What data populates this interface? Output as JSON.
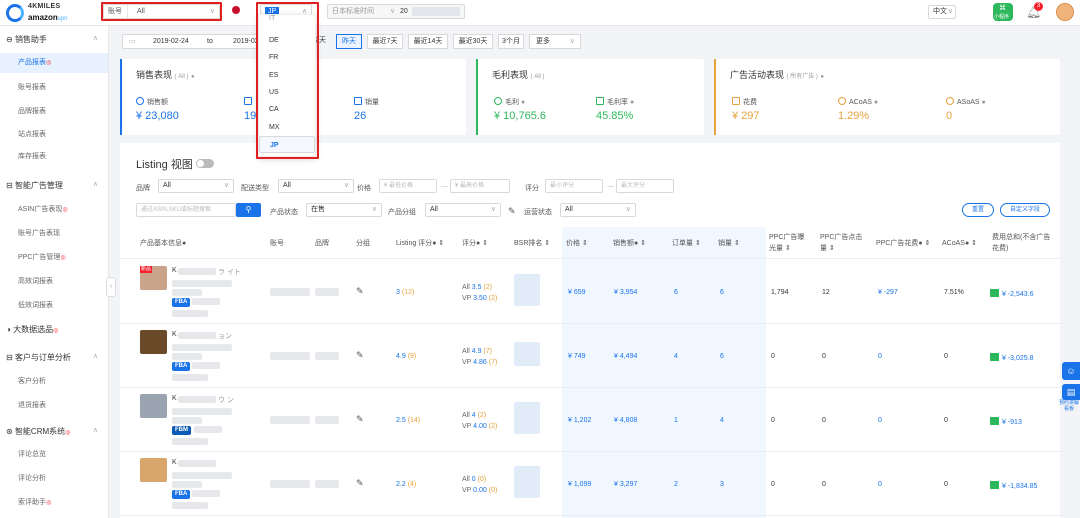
{
  "brand": {
    "line1": "4KMILES",
    "line2": "amazon",
    "line2_suffix": "spn"
  },
  "topbar": {
    "account_label": "账号",
    "account_value": "All",
    "marketplace_value": "JP",
    "timezone_value": "日本标准时间",
    "timezone_date": "20",
    "language": "中文",
    "miniprogram_label": "小程序",
    "notification_count": "3"
  },
  "marketplace_dropdown": {
    "items": [
      "IT",
      "DE",
      "FR",
      "ES",
      "US",
      "CA",
      "MX",
      "JP"
    ],
    "selected": "JP"
  },
  "sidebar": {
    "groups": [
      {
        "label": "销售助手",
        "items": [
          {
            "label": "产品报表",
            "hot": true,
            "active": true
          },
          {
            "label": "账号报表",
            "hot": false
          },
          {
            "label": "品牌报表",
            "hot": false
          },
          {
            "label": "站点报表",
            "hot": false
          },
          {
            "label": "库存报表",
            "hot": false
          }
        ]
      },
      {
        "label": "智能广告管理",
        "items": [
          {
            "label": "ASIN广告表现",
            "hot": true
          },
          {
            "label": "账号广告表现",
            "hot": false
          },
          {
            "label": "PPC广告管理",
            "hot": true
          },
          {
            "label": "高效词报表",
            "hot": false
          },
          {
            "label": "低效词报表",
            "hot": false
          }
        ]
      },
      {
        "label": "大数据选品",
        "hot": true,
        "items": []
      },
      {
        "label": "客户与订单分析",
        "items": [
          {
            "label": "客户分析",
            "hot": false
          },
          {
            "label": "退货报表",
            "hot": false
          }
        ]
      },
      {
        "label": "智能CRM系统",
        "hot": true,
        "items": [
          {
            "label": "评论总览",
            "hot": false
          },
          {
            "label": "评论分析",
            "hot": false
          },
          {
            "label": "索评助手",
            "hot": true
          }
        ]
      }
    ],
    "hot_mark": "◎"
  },
  "datebar": {
    "start": "2019-02-24",
    "to": "to",
    "end": "2019-02",
    "quick": [
      {
        "label": "今天",
        "active": false
      },
      {
        "label": "昨天",
        "active": true
      },
      {
        "label": "最近7天",
        "active": false
      },
      {
        "label": "最近14天",
        "active": false
      },
      {
        "label": "最近30天",
        "active": false
      },
      {
        "label": "3个月",
        "active": false
      },
      {
        "label": "更多",
        "active": false
      }
    ]
  },
  "cards": {
    "sales": {
      "title": "销售表现",
      "scope": "( All )",
      "metrics": [
        {
          "label": "销售额",
          "value": "¥ 23,080"
        },
        {
          "label": "",
          "value": "19"
        },
        {
          "label": "销量",
          "value": "26"
        }
      ]
    },
    "profit": {
      "title": "毛利表现",
      "scope": "( All )",
      "metrics": [
        {
          "label": "毛利",
          "value": "¥ 10,765.6"
        },
        {
          "label": "毛利率",
          "value": "45.85%"
        }
      ]
    },
    "ads": {
      "title": "广告活动表现",
      "scope": "( 所有广告 )",
      "metrics": [
        {
          "label": "花费",
          "value": "¥ 297"
        },
        {
          "label": "ACoAS",
          "value": "1.29%"
        },
        {
          "label": "ASoAS",
          "value": "0"
        }
      ]
    },
    "accent_colors": {
      "sales": "#1a73e8",
      "profit": "#2eb85c",
      "ads": "#e6a23c"
    }
  },
  "listing": {
    "title": "Listing 视图",
    "filters": {
      "brand_label": "品牌",
      "brand_value": "All",
      "delivery_label": "配送类型",
      "delivery_value": "All",
      "price_label": "价格",
      "price_min": "最低价格",
      "price_max": "最高价格",
      "rating_label": "评分",
      "rating_min": "最小评分",
      "rating_max": "最大评分",
      "search_placeholder": "通过ASIN,SKU或标题搜索",
      "status_label": "产品状态",
      "status_value": "在售",
      "group_label": "产品分组",
      "group_value": "All",
      "ops_label": "运营状态",
      "ops_value": "All",
      "reset_label": "重置",
      "custom_label": "自定义字段"
    },
    "columns": [
      "产品基本信息",
      "账号",
      "品牌",
      "分组",
      "Listing 评分",
      "评分",
      "BSR排名",
      "价格",
      "销售额",
      "订单量",
      "销量",
      "PPC广告曝光量",
      "PPC广告点击量",
      "PPC广告花费",
      "ACoAS",
      "费用总和(不含广告花费)"
    ],
    "rows": [
      {
        "title_prefix": "K",
        "title_tail": "ラ イト",
        "fulfill": "FBA",
        "listing_score": "3",
        "listing_count": "(12)",
        "rating_all": "3.5",
        "rating_all_n": "(2)",
        "rating_vp": "3.50",
        "rating_vp_n": "(2)",
        "price": "¥ 659",
        "sales": "¥ 3,954",
        "orders": "6",
        "units": "6",
        "impressions": "1,794",
        "clicks": "12",
        "spend": "¥ -297",
        "acoas": "7.51%",
        "fees": "¥ -2,543.6",
        "thumb_color": "#c9a38a",
        "new_badge": "新品"
      },
      {
        "title_prefix": "K",
        "title_tail": "ョン",
        "fulfill": "FBA",
        "listing_score": "4.9",
        "listing_count": "(9)",
        "rating_all": "4.9",
        "rating_all_n": "(7)",
        "rating_vp": "4.86",
        "rating_vp_n": "(7)",
        "price": "¥ 749",
        "sales": "¥ 4,494",
        "orders": "4",
        "units": "6",
        "impressions": "0",
        "clicks": "0",
        "spend": "0",
        "acoas": "0",
        "fees": "¥ -3,025.8",
        "thumb_color": "#6b4a2a",
        "new_badge": ""
      },
      {
        "title_prefix": "K",
        "title_tail": "ウ ン",
        "fulfill": "FBM",
        "listing_score": "2.5",
        "listing_count": "(14)",
        "rating_all": "4",
        "rating_all_n": "(2)",
        "rating_vp": "4.00",
        "rating_vp_n": "(2)",
        "price": "¥ 1,202",
        "sales": "¥ 4,808",
        "orders": "1",
        "units": "4",
        "impressions": "0",
        "clicks": "0",
        "spend": "0",
        "acoas": "0",
        "fees": "¥ -913",
        "thumb_color": "#9aa3b0",
        "new_badge": ""
      },
      {
        "title_prefix": "K",
        "title_tail": "",
        "fulfill": "FBA",
        "listing_score": "2.2",
        "listing_count": "(4)",
        "rating_all": "0",
        "rating_all_n": "(0)",
        "rating_vp": "0.00",
        "rating_vp_n": "(0)",
        "price": "¥ 1,099",
        "sales": "¥ 3,297",
        "orders": "2",
        "units": "3",
        "impressions": "0",
        "clicks": "0",
        "spend": "0",
        "acoas": "0",
        "fees": "¥ -1,834.85",
        "thumb_color": "#d8a56a",
        "new_badge": ""
      }
    ],
    "rating_all_label": "All",
    "rating_vp_label": "VP"
  },
  "floating": {
    "label": "预约讲解看板"
  }
}
